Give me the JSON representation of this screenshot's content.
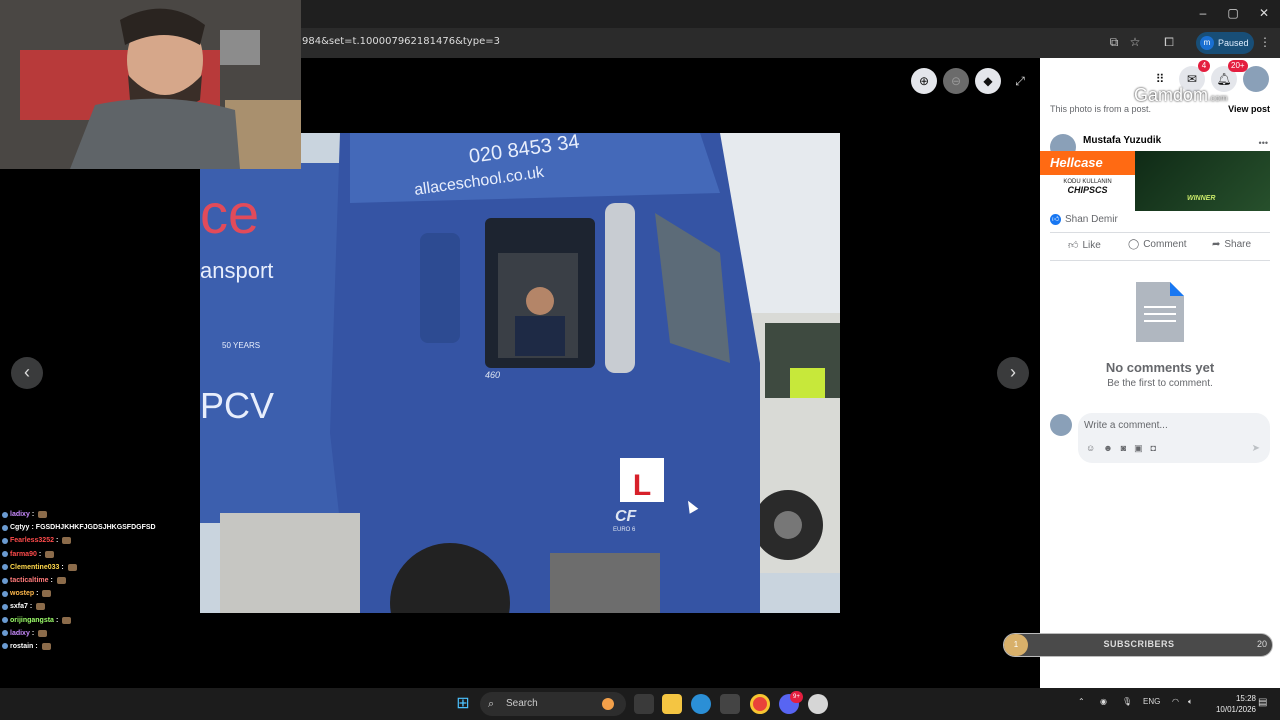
{
  "browser": {
    "url": "984&set=t.100007962181476&type=3",
    "profile_badge": "m",
    "profile_status": "Paused",
    "window_controls": [
      "–",
      "▢",
      "✕"
    ]
  },
  "viewer": {
    "prev_label": "‹",
    "next_label": "›",
    "zoom_in_icon": "zoom-in-icon",
    "zoom_out_icon": "zoom-out-icon",
    "tag_icon": "tag-icon",
    "fullscreen_icon": "fullscreen-icon"
  },
  "photo": {
    "phone_text": "020 8453 34",
    "website_text": "allaceschool.co.uk",
    "side_text_1": "ce",
    "side_text_2": "ansport",
    "side_text_3": "PCV",
    "model_text": "460",
    "years_text": "50 YEARS",
    "l_plate": "L",
    "brand_text": "CF",
    "euro_text": "EURO 6"
  },
  "stream_chat": [
    {
      "user": "ladixy",
      "color": "#c98bff",
      "msg": ""
    },
    {
      "user": "Cgtyy",
      "color": "#ffffff",
      "msg": "FGSDHJKHKFJGDSJHKGSFDGFSD"
    },
    {
      "user": "Fearless3252",
      "color": "#ff4b4b",
      "msg": ""
    },
    {
      "user": "farma90",
      "color": "#ff4b4b",
      "msg": ""
    },
    {
      "user": "Clementine033",
      "color": "#ffd84b",
      "msg": ""
    },
    {
      "user": "tacticaltime",
      "color": "#ff7a7a",
      "msg": ""
    },
    {
      "user": "wostep",
      "color": "#ffb84b",
      "msg": ""
    },
    {
      "user": "sxfa7",
      "color": "#ffffff",
      "msg": ""
    },
    {
      "user": "orijingangsta",
      "color": "#9dff6a",
      "msg": ""
    },
    {
      "user": "ladixy",
      "color": "#c98bff",
      "msg": ""
    },
    {
      "user": "rostain",
      "color": "#ffffff",
      "msg": ""
    }
  ],
  "panel": {
    "messenger_badge": "4",
    "notif_badge": "20+",
    "overlay_brand": "Gamdom",
    "overlay_brand_suffix": ".com",
    "from_post": "This photo is from a post.",
    "view_post": "View post",
    "author": "Mustafa Yuzudik",
    "more": "•••",
    "sponsor": {
      "brand": "Hellcase",
      "sub": "KODU KULLANIN",
      "code": "CHIPSCS",
      "winner": "WINNER"
    },
    "liker": "Shan Demir",
    "actions": {
      "like": "Like",
      "comment": "Comment",
      "share": "Share"
    },
    "no_comments_title": "No comments yet",
    "no_comments_sub": "Be the first to comment.",
    "comment_placeholder": "Write a comment..."
  },
  "subscribers": {
    "start": "1",
    "label": "SUBSCRIBERS",
    "goal": "20"
  },
  "taskbar": {
    "search_label": "Search",
    "lang": "ENG",
    "time": "15:28",
    "date": "10/01/2026",
    "discord_badge": "9+"
  }
}
